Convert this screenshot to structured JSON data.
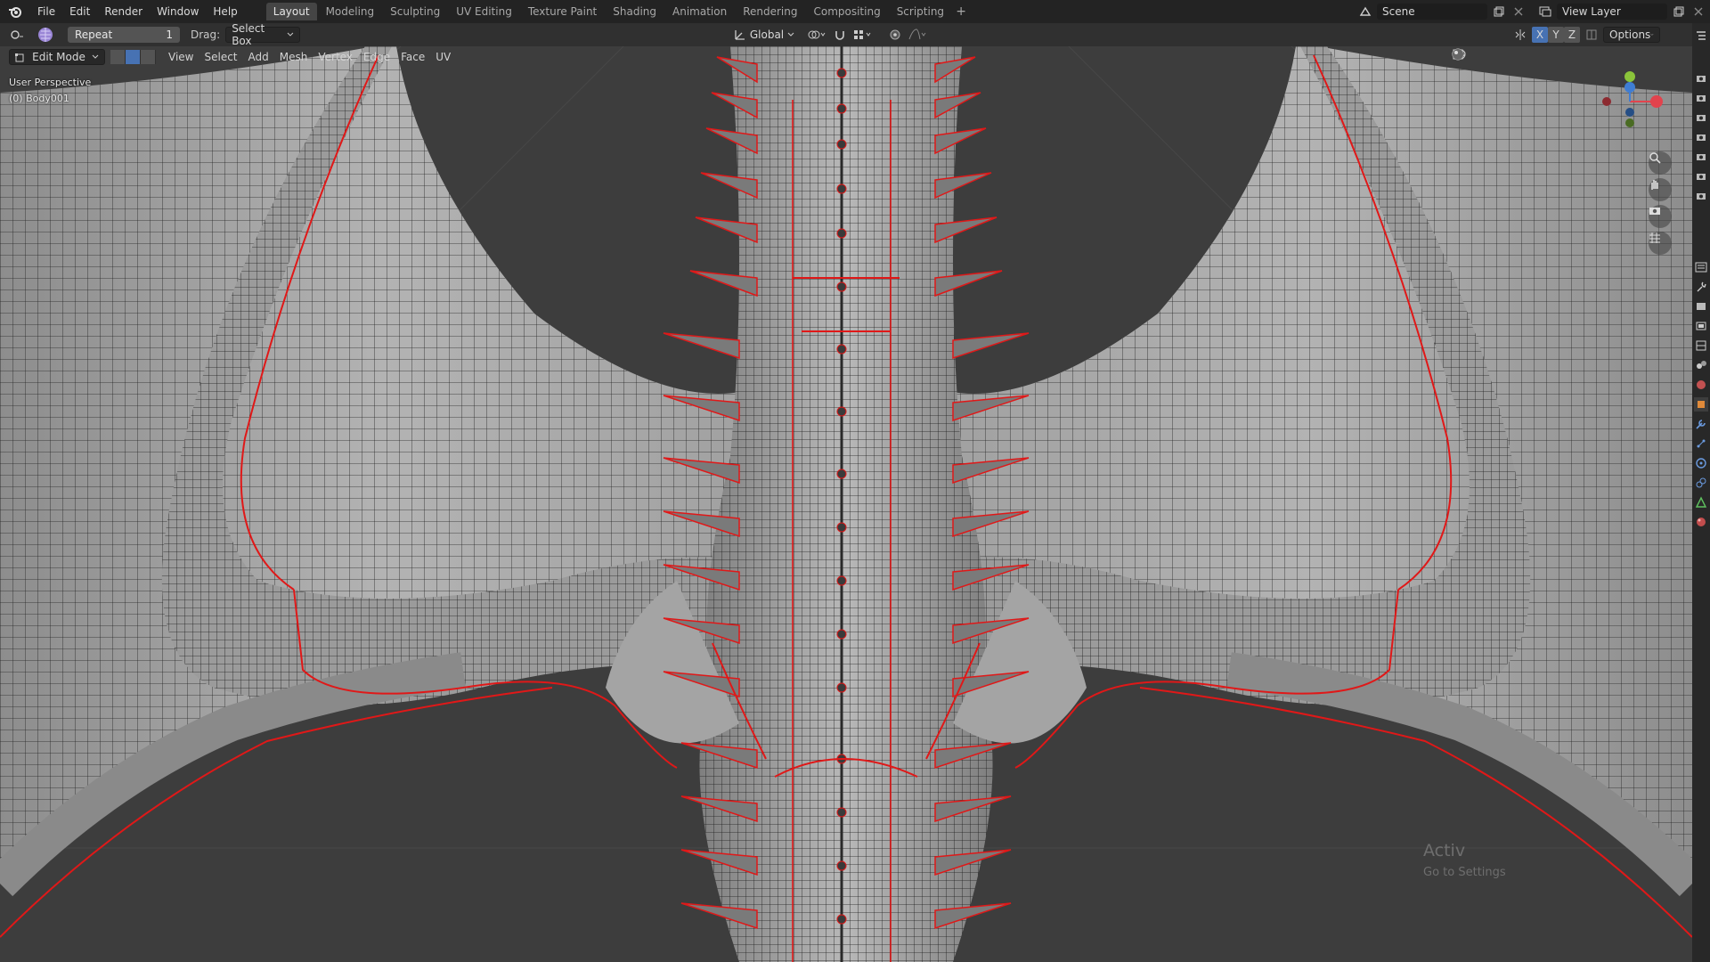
{
  "menu": [
    "File",
    "Edit",
    "Render",
    "Window",
    "Help"
  ],
  "workspaces": [
    "Layout",
    "Modeling",
    "Sculpting",
    "UV Editing",
    "Texture Paint",
    "Shading",
    "Animation",
    "Rendering",
    "Compositing",
    "Scripting"
  ],
  "active_workspace": "Layout",
  "scene": "Scene",
  "view_layer": "View Layer",
  "toolheader": {
    "repeat_label": "Repeat",
    "repeat_value": "1",
    "drag_label": "Drag:",
    "drag_value": "Select Box",
    "orientation": "Global",
    "options": "Options",
    "axes": [
      "X",
      "Y",
      "Z"
    ]
  },
  "editorheader": {
    "mode": "Edit Mode",
    "menus": [
      "View",
      "Select",
      "Add",
      "Mesh",
      "Vertex",
      "Edge",
      "Face",
      "UV"
    ]
  },
  "viewport": {
    "perspective": "User Perspective",
    "object": "(0) Body001",
    "watermark_line1": "Activ",
    "watermark_line2": "Go to Settings"
  },
  "colors": {
    "seam": "#e01818",
    "mesh_face": "#a9a9a9",
    "wire": "#1a1a1a",
    "bg": "#3d3d3d",
    "accent": "#4772b3"
  }
}
